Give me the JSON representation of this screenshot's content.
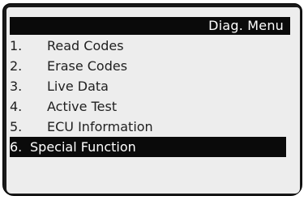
{
  "menu": {
    "title": "Diag. Menu",
    "items": [
      {
        "number": "1.",
        "label": "Read Codes"
      },
      {
        "number": "2.",
        "label": "Erase Codes"
      },
      {
        "number": "3.",
        "label": "Live Data"
      },
      {
        "number": "4.",
        "label": "Active Test"
      },
      {
        "number": "5.",
        "label": "ECU Information"
      },
      {
        "number": "6.",
        "label": "Special Function"
      }
    ],
    "selected_index": 5
  },
  "colors": {
    "bezel": "#1a1a1a",
    "screen": "#ededed",
    "highlight": "#0a0a0a",
    "text": "#1f1f1f",
    "highlight_text": "#ffffff"
  }
}
